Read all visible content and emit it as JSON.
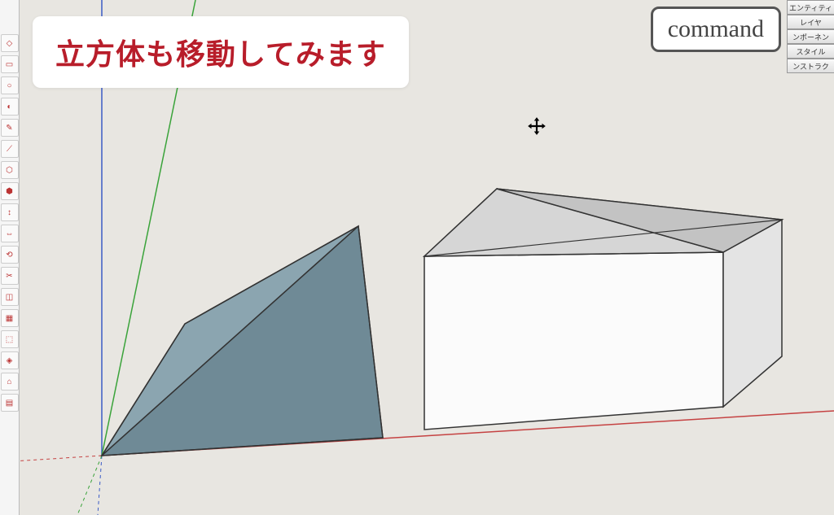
{
  "caption": "立方体も移動してみます",
  "command_label": "command",
  "panels": [
    "エンティティ",
    "レイヤ",
    "ンポーネン",
    "スタイル",
    "ンストラク"
  ],
  "colors": {
    "background": "#e8e6e1",
    "axis_red": "#c54242",
    "axis_green": "#3aa33a",
    "axis_blue": "#3a5bc5",
    "caption_text": "#b81d2a",
    "shape_blue_top": "#8ba5b0",
    "shape_blue_side": "#6f8a96",
    "cube_top": "#d6d6d6",
    "cube_front": "#fbfbfb",
    "cube_side": "#e4e4e4"
  },
  "toolbar_count": 18
}
